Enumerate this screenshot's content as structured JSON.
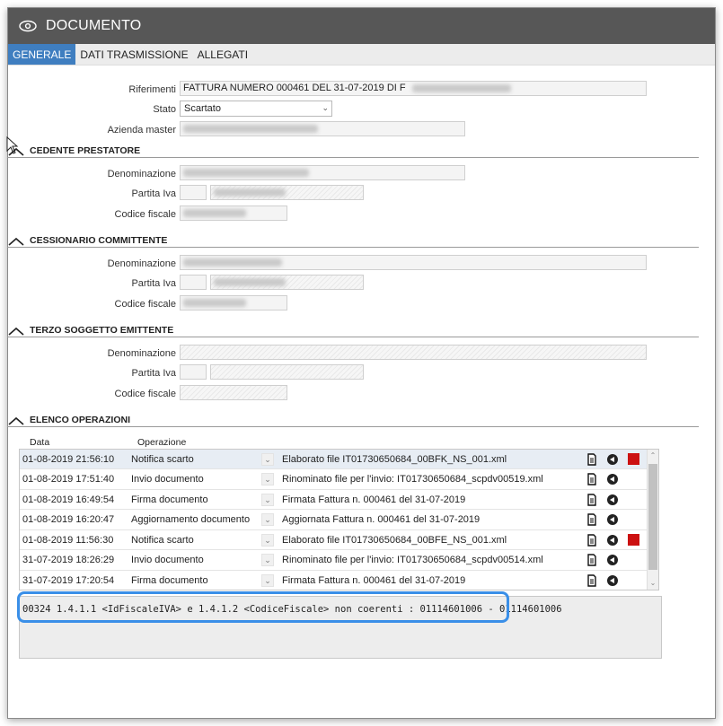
{
  "window": {
    "title": "DOCUMENTO"
  },
  "tabs": [
    {
      "label": "GENERALE",
      "active": true
    },
    {
      "label": "DATI TRASMISSIONE",
      "active": false
    },
    {
      "label": "ALLEGATI",
      "active": false
    }
  ],
  "general": {
    "riferimenti_label": "Riferimenti",
    "riferimenti_value": "FATTURA NUMERO 000461 DEL 31-07-2019 DI F",
    "stato_label": "Stato",
    "stato_value": "Scartato",
    "azienda_label": "Azienda master"
  },
  "cedente": {
    "title": "CEDENTE PRESTATORE",
    "denominazione_label": "Denominazione",
    "partita_iva_label": "Partita Iva",
    "codice_fiscale_label": "Codice fiscale"
  },
  "cessionario": {
    "title": "CESSIONARIO COMMITTENTE",
    "denominazione_label": "Denominazione",
    "partita_iva_label": "Partita Iva",
    "codice_fiscale_label": "Codice fiscale"
  },
  "terzo": {
    "title": "TERZO SOGGETTO EMITTENTE",
    "denominazione_label": "Denominazione",
    "partita_iva_label": "Partita Iva",
    "codice_fiscale_label": "Codice fiscale"
  },
  "operazioni": {
    "title": "ELENCO OPERAZIONI",
    "col_data": "Data",
    "col_operazione": "Operazione",
    "rows": [
      {
        "date": "01-08-2019 21:56:10",
        "op": "Notifica scarto",
        "desc": "Elaborato file IT01730650684_00BFK_NS_001.xml",
        "red": true
      },
      {
        "date": "01-08-2019 17:51:40",
        "op": "Invio documento",
        "desc": "Rinominato file per l'invio: IT01730650684_scpdv00519.xml",
        "red": false
      },
      {
        "date": "01-08-2019 16:49:54",
        "op": "Firma documento",
        "desc": "Firmata Fattura n. 000461 del 31-07-2019",
        "red": false
      },
      {
        "date": "01-08-2019 16:20:47",
        "op": "Aggiornamento documento",
        "desc": "Aggiornata Fattura n. 000461 del 31-07-2019",
        "red": false
      },
      {
        "date": "01-08-2019 11:56:30",
        "op": "Notifica scarto",
        "desc": "Elaborato file IT01730650684_00BFE_NS_001.xml",
        "red": true
      },
      {
        "date": "31-07-2019 18:26:29",
        "op": "Invio documento",
        "desc": "Rinominato file per l'invio: IT01730650684_scpdv00514.xml",
        "red": false
      },
      {
        "date": "31-07-2019 17:20:54",
        "op": "Firma documento",
        "desc": "Firmata Fattura n. 000461 del 31-07-2019",
        "red": false
      }
    ],
    "detail_text": "00324 1.4.1.1 <IdFiscaleIVA> e 1.4.1.2 <CodiceFiscale> non coerenti : 01114601006 - 01114601006"
  },
  "colors": {
    "titlebar": "#575757",
    "tab_active": "#3f7ec0",
    "highlight": "#3a8fe8",
    "error_flag": "#cc1111"
  }
}
